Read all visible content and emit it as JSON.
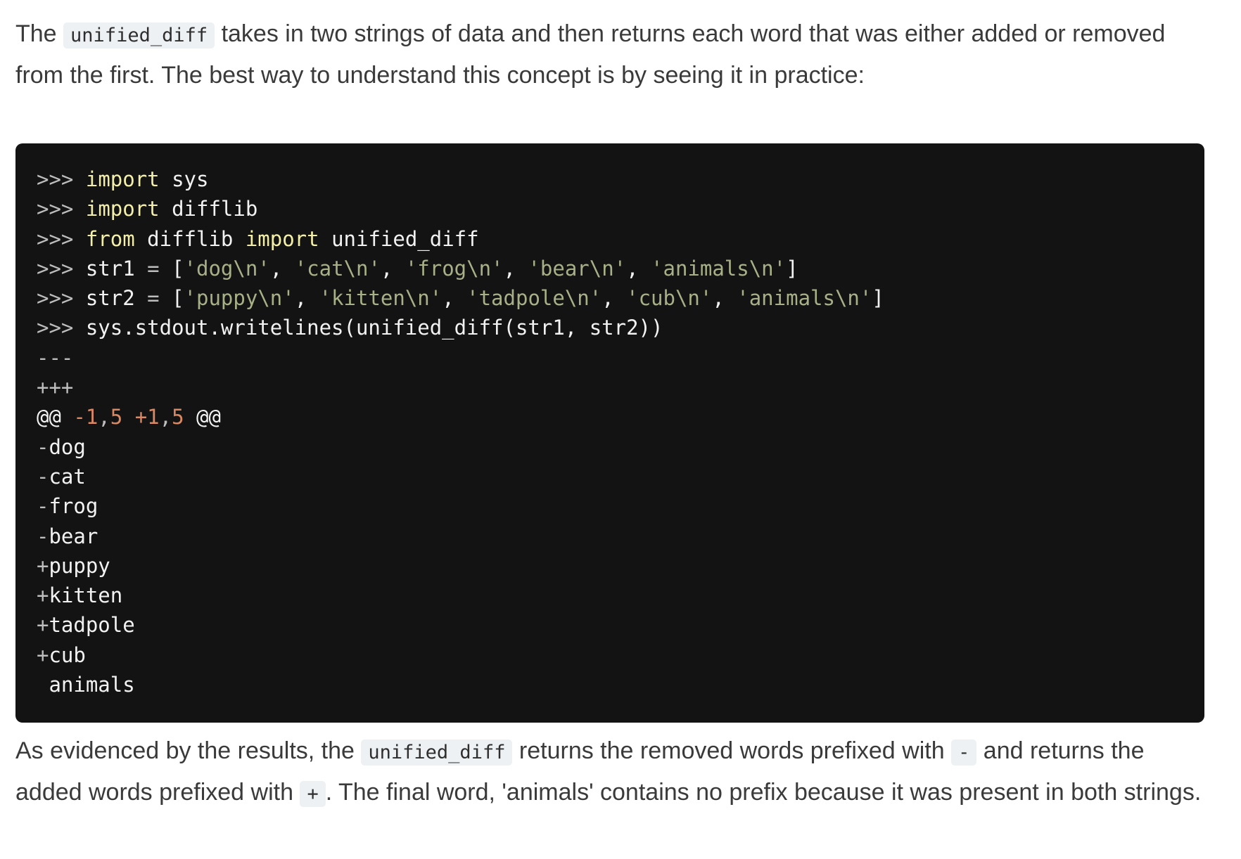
{
  "intro": {
    "before": "The ",
    "code": "unified_diff",
    "after": " takes in two strings of data and then returns each word that was either added or removed from the first. The best way to understand this concept is by seeing it in practice:"
  },
  "code": {
    "prompt": ">>>",
    "line1": {
      "kw": "import",
      "rest": " sys"
    },
    "line2": {
      "kw": "import",
      "rest": " difflib"
    },
    "line3": {
      "kw1": "from",
      "mid": " difflib ",
      "kw2": "import",
      "rest": " unified_diff"
    },
    "line4": {
      "name": " str1 ",
      "eq": "=",
      "open": " [",
      "items": [
        "'dog\\n'",
        "'cat\\n'",
        "'frog\\n'",
        "'bear\\n'",
        "'animals\\n'"
      ],
      "close": "]"
    },
    "line5": {
      "name": " str2 ",
      "eq": "=",
      "open": " [",
      "items": [
        "'puppy\\n'",
        "'kitten\\n'",
        "'tadpole\\n'",
        "'cub\\n'",
        "'animals\\n'"
      ],
      "close": "]"
    },
    "line6": {
      "a": " sys",
      "b": ".stdout",
      "c": ".writelines(unified_diff(str1, str2))"
    },
    "out_minus_header": "---",
    "out_plus_header": "+++",
    "hunk": {
      "at1": "@@",
      "minus": "-1",
      "c1": ",",
      "n1": "5",
      "plus": "+1",
      "c2": ",",
      "n2": "5",
      "at2": "@@"
    },
    "removed": [
      "dog",
      "cat",
      "frog",
      "bear"
    ],
    "added": [
      "puppy",
      "kitten",
      "tadpole",
      "cub"
    ],
    "minus_sign": "-",
    "plus_sign": "+",
    "common": " animals"
  },
  "outro": {
    "t1": "As evidenced by the results, the ",
    "code1": "unified_diff",
    "t2": " returns the removed words prefixed with ",
    "code2": "-",
    "t3": " and returns the added words prefixed with ",
    "code3": "+",
    "t4": ". The final word, 'animals' contains no prefix because it was present in both strings."
  }
}
